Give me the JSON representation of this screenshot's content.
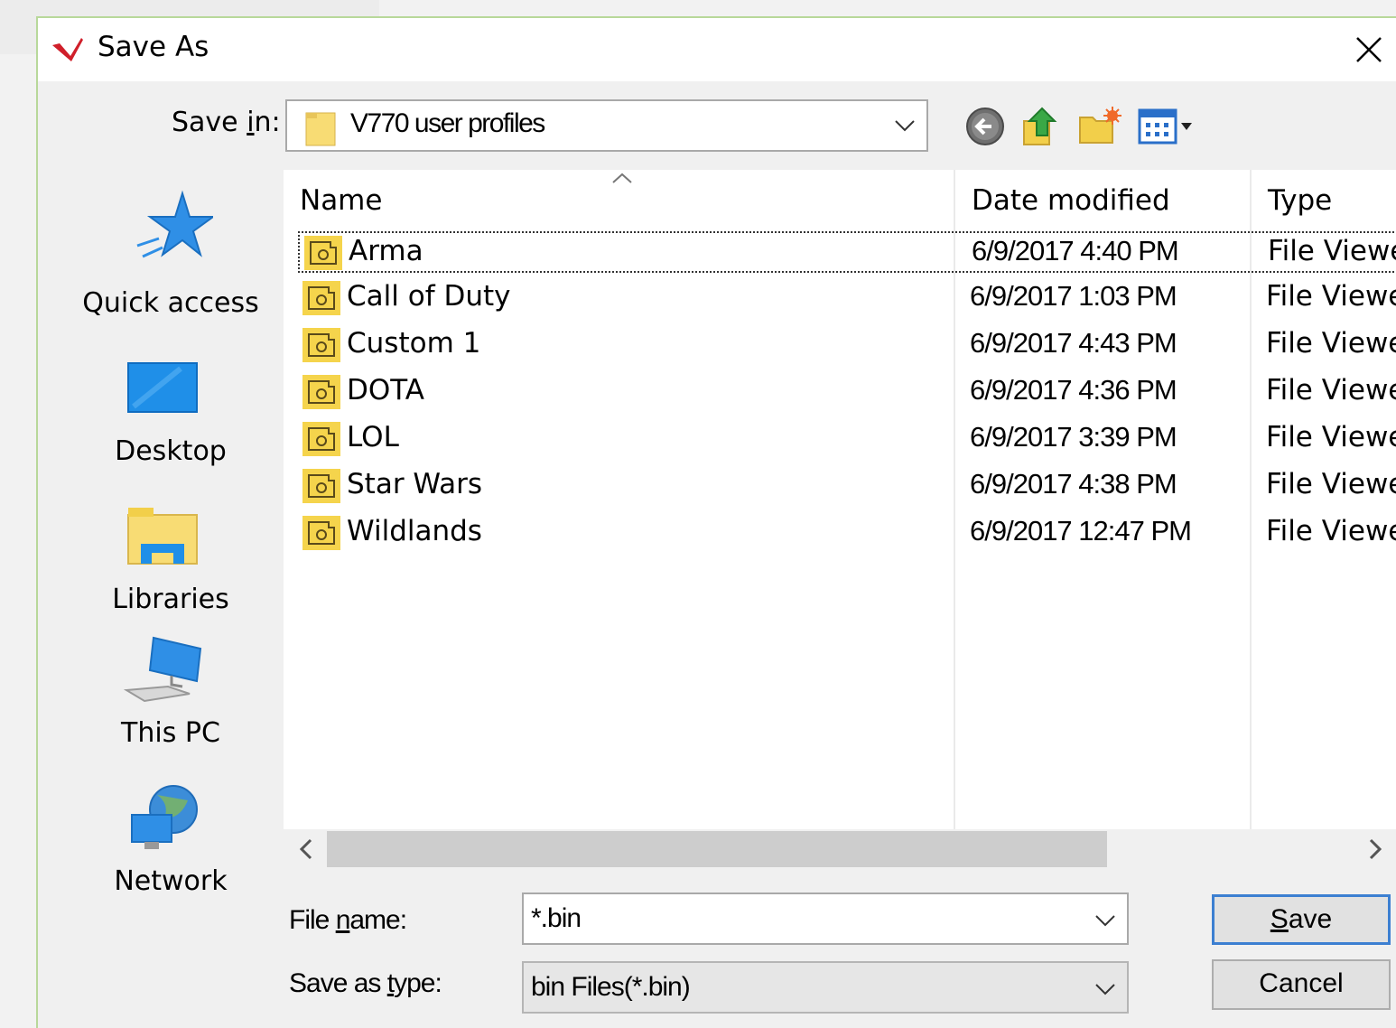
{
  "window": {
    "title": "Save As",
    "close_glyph": "✕"
  },
  "save_in": {
    "label_pre": "Save ",
    "label_ul": "i",
    "label_post": "n:",
    "value": "V770 user profiles"
  },
  "toolbar": {
    "icons": [
      "back-icon",
      "up-folder-icon",
      "new-folder-icon",
      "view-menu-icon"
    ]
  },
  "places": [
    {
      "label": "Quick access",
      "icon": "star-icon"
    },
    {
      "label": "Desktop",
      "icon": "desktop-icon"
    },
    {
      "label": "Libraries",
      "icon": "libraries-icon"
    },
    {
      "label": "This PC",
      "icon": "computer-icon"
    },
    {
      "label": "Network",
      "icon": "network-icon"
    }
  ],
  "columns": {
    "name": "Name",
    "date": "Date modified",
    "type": "Type"
  },
  "files": [
    {
      "name": "Arma",
      "date": "6/9/2017 4:40 PM",
      "type": "File Viewe"
    },
    {
      "name": "Call of Duty",
      "date": "6/9/2017 1:03 PM",
      "type": "File Viewe"
    },
    {
      "name": "Custom 1",
      "date": "6/9/2017 4:43 PM",
      "type": "File Viewe"
    },
    {
      "name": "DOTA",
      "date": "6/9/2017 4:36 PM",
      "type": "File Viewe"
    },
    {
      "name": "LOL",
      "date": "6/9/2017 3:39 PM",
      "type": "File Viewe"
    },
    {
      "name": "Star Wars",
      "date": "6/9/2017 4:38 PM",
      "type": "File Viewe"
    },
    {
      "name": "Wildlands",
      "date": "6/9/2017 12:47 PM",
      "type": "File Viewe"
    }
  ],
  "filename": {
    "label_pre": "File ",
    "label_ul": "n",
    "label_post": "ame:",
    "value": "*.bin"
  },
  "filetype": {
    "label_pre": "Save as ",
    "label_ul": "t",
    "label_post": "ype:",
    "value": "bin Files(*.bin)"
  },
  "buttons": {
    "save_ul": "S",
    "save_rest": "ave",
    "cancel": "Cancel"
  },
  "colors": {
    "accent": "#3c7fd1",
    "folder": "#f5d44c",
    "title_icon": "#d01f2a"
  }
}
